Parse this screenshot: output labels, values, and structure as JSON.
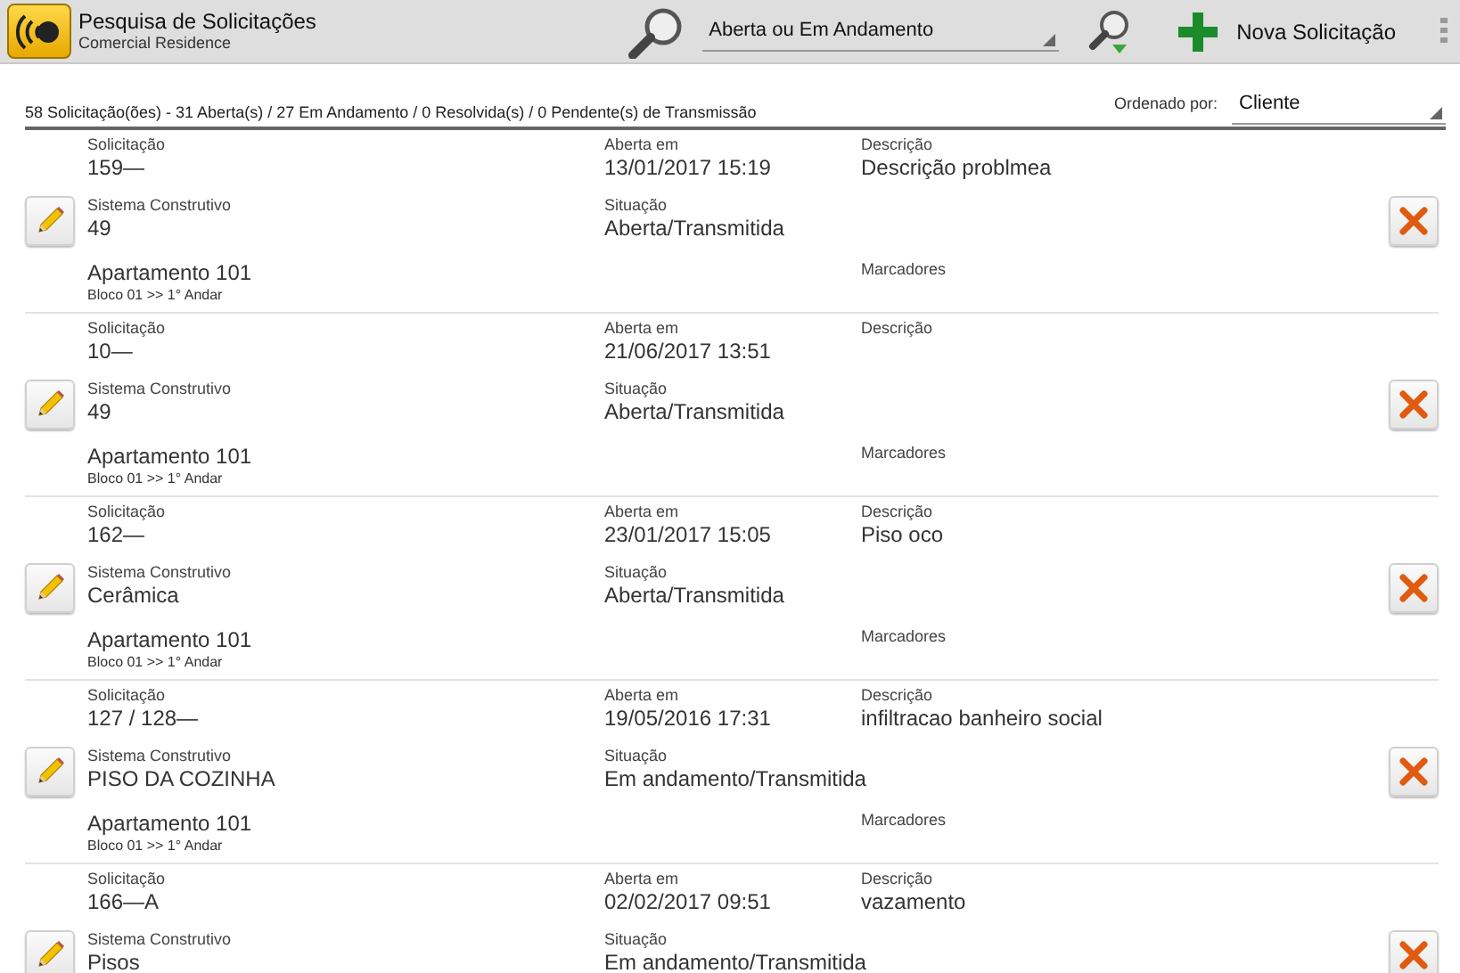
{
  "toolbar": {
    "title": "Pesquisa de Solicitações",
    "subtitle": "Comercial Residence",
    "filter": "Aberta ou Em Andamento",
    "new_button": "Nova Solicitação"
  },
  "summary": "58 Solicitação(ões) - 31 Aberta(s) / 27 Em Andamento / 0 Resolvida(s) / 0 Pendente(s) de Transmissão",
  "sort": {
    "label": "Ordenado por:",
    "value": "Cliente"
  },
  "records": [
    {
      "solicitacao_label": "Solicitação",
      "solicitacao": "159—",
      "aberta_label": "Aberta em",
      "aberta": "13/01/2017 15:19",
      "descricao_label": "Descrição",
      "descricao": "Descrição problmea",
      "sistema_label": "Sistema Construtivo",
      "sistema": "49",
      "situacao_label": "Situação",
      "situacao": "Aberta/Transmitida",
      "unidade": "Apartamento 101",
      "local": "Bloco 01 >> 1° Andar",
      "marcadores_label": "Marcadores"
    },
    {
      "solicitacao_label": "Solicitação",
      "solicitacao": "10—",
      "aberta_label": "Aberta em",
      "aberta": "21/06/2017 13:51",
      "descricao_label": "Descrição",
      "sistema_label": "Sistema Construtivo",
      "sistema": "49",
      "situacao_label": "Situação",
      "situacao": "Aberta/Transmitida",
      "unidade": "Apartamento 101",
      "local": "Bloco 01 >> 1° Andar",
      "marcadores_label": "Marcadores"
    },
    {
      "solicitacao_label": "Solicitação",
      "solicitacao": "162—",
      "aberta_label": "Aberta em",
      "aberta": "23/01/2017 15:05",
      "descricao_label": "Descrição",
      "descricao": "Piso oco",
      "sistema_label": "Sistema Construtivo",
      "sistema": "Cerâmica",
      "situacao_label": "Situação",
      "situacao": "Aberta/Transmitida",
      "unidade": "Apartamento 101",
      "local": "Bloco 01 >> 1° Andar",
      "marcadores_label": "Marcadores"
    },
    {
      "solicitacao_label": "Solicitação",
      "solicitacao": "127 / 128—",
      "aberta_label": "Aberta em",
      "aberta": "19/05/2016 17:31",
      "descricao_label": "Descrição",
      "descricao": "infiltracao banheiro social",
      "sistema_label": "Sistema Construtivo",
      "sistema": "PISO DA COZINHA",
      "situacao_label": "Situação",
      "situacao": "Em andamento/Transmitida",
      "unidade": "Apartamento 101",
      "local": "Bloco 01 >> 1° Andar",
      "marcadores_label": "Marcadores"
    },
    {
      "solicitacao_label": "Solicitação",
      "solicitacao": "166—A",
      "aberta_label": "Aberta em",
      "aberta": "02/02/2017 09:51",
      "descricao_label": "Descrição",
      "descricao": "vazamento",
      "sistema_label": "Sistema Construtivo",
      "sistema": "Pisos",
      "situacao_label": "Situação",
      "situacao": "Em andamento/Transmitida"
    }
  ]
}
